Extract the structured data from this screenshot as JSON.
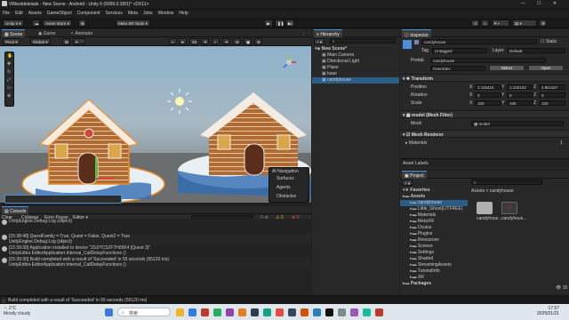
{
  "window": {
    "title": "VRtestdeletask - New Scene - Android - Unity 6 (6000.0.35f1)* <DX11>"
  },
  "menu": [
    "File",
    "Edit",
    "Assets",
    "GameObject",
    "Component",
    "Services",
    "Meta",
    "Jobs",
    "Window",
    "Help"
  ],
  "toolbar": {
    "account": "Unity 6",
    "asset_store": "Asset Store",
    "meta_tools": "Meta XR Tools"
  },
  "scene": {
    "tabs": [
      "Scene",
      "Game",
      "Animator"
    ],
    "pivot": "Pivot",
    "global": "Global",
    "view_2d": "2D",
    "overlay_items": [
      "AI Navigation",
      "Surfaces",
      "Agents",
      "Obstacles"
    ]
  },
  "hierarchy": {
    "tab": "Hierarchy",
    "items": [
      {
        "label": "New Scene*",
        "indent": 0,
        "selected": false,
        "bold": true
      },
      {
        "label": "Main Camera",
        "indent": 1,
        "selected": false,
        "bold": false
      },
      {
        "label": "Directional Light",
        "indent": 1,
        "selected": false,
        "bold": false
      },
      {
        "label": "Plane",
        "indent": 1,
        "selected": false,
        "bold": false
      },
      {
        "label": "base",
        "indent": 1,
        "selected": false,
        "bold": false
      },
      {
        "label": "candyhouse",
        "indent": 1,
        "selected": true,
        "bold": false
      }
    ]
  },
  "inspector": {
    "tab": "Inspector",
    "object_name": "candyhouse",
    "static_label": "Static",
    "tag_label": "Tag",
    "tag_value": "Untagged",
    "layer_label": "Layer",
    "layer_value": "Default",
    "prefab_label": "Prefab",
    "prefab_value": "candyhouse",
    "overrides": "Overrides",
    "select": "Select",
    "open": "Open",
    "transform": {
      "title": "Transform",
      "rows": [
        {
          "label": "Position",
          "x": "2.116315",
          "y": "1.102102",
          "z": "4.851167"
        },
        {
          "label": "Rotation",
          "x": "0",
          "y": "0",
          "z": "0"
        },
        {
          "label": "Scale",
          "x": "100",
          "y": "100",
          "z": "100"
        }
      ]
    },
    "mesh_filter": {
      "title": "model (Mesh Filter)",
      "mesh_label": "Mesh",
      "mesh_value": "model"
    },
    "mesh_renderer": {
      "title": "Mesh Renderer"
    },
    "materials_label": "Materials",
    "materials_count": "1",
    "asset_labels": "Asset Labels"
  },
  "project": {
    "tab": "Project",
    "tree": [
      {
        "label": "Favorites",
        "indent": 0,
        "bold": true
      },
      {
        "label": "Assets",
        "indent": 0,
        "bold": true
      },
      {
        "label": "candyhouse",
        "indent": 1,
        "bold": false,
        "selected": true
      },
      {
        "label": "Little_Ghost(LITFREE)",
        "indent": 1,
        "bold": false
      },
      {
        "label": "Materials",
        "indent": 1,
        "bold": false
      },
      {
        "label": "MetaXR",
        "indent": 1,
        "bold": false
      },
      {
        "label": "Oculus",
        "indent": 1,
        "bold": false
      },
      {
        "label": "Plugins",
        "indent": 1,
        "bold": false
      },
      {
        "label": "Resources",
        "indent": 1,
        "bold": false
      },
      {
        "label": "Scenes",
        "indent": 1,
        "bold": false
      },
      {
        "label": "Settings",
        "indent": 1,
        "bold": false
      },
      {
        "label": "Shaded",
        "indent": 1,
        "bold": false
      },
      {
        "label": "StreamingAssets",
        "indent": 1,
        "bold": false
      },
      {
        "label": "TutorialInfo",
        "indent": 1,
        "bold": false
      },
      {
        "label": "XR",
        "indent": 1,
        "bold": false
      },
      {
        "label": "Packages",
        "indent": 0,
        "bold": true
      }
    ],
    "breadcrumb_root": "Assets",
    "breadcrumb_sep": ">",
    "breadcrumb_current": "candyhouse",
    "assets": [
      {
        "label": "candyhous..."
      },
      {
        "label": "candyhous..."
      }
    ],
    "count": "15"
  },
  "console": {
    "tab": "Console",
    "clear": "Clear",
    "collapse": "Collapse",
    "error_pause": "Error Pause",
    "editor": "Editor",
    "counts": [
      "0",
      "0",
      "0"
    ],
    "rows": [
      {
        "line1": "UnityEngine.Debug:Log (object)",
        "line2": ""
      },
      {
        "line1": "[15:38:48] QuestFamily = True, Quest = False, Quest2 = True",
        "line2": "UnityEngine.Debug:Log (object)"
      },
      {
        "line1": "[15:39:30] Application installed to device \"2G0YC5ZF7H05K4 [Quest 3]\".",
        "line2": "UnityEditor.EditorApplication:Internal_CallDelayFunctions ()"
      },
      {
        "line1": "[15:39:30] Build completed with a result of 'Succeeded' in 55 seconds (55120 ms)",
        "line2": "UnityEditor.EditorApplication:Internal_CallDelayFunctions ()"
      }
    ]
  },
  "statusbar": {
    "text": "Build completed with a result of 'Succeeded' in 55 seconds (55120 ms)"
  },
  "taskbar": {
    "weather_temp": "2°C",
    "weather_desc": "Mostly cloudy",
    "search": "検索",
    "time": "17:57",
    "date": "2025/01/21"
  },
  "colors": {
    "selection": "#2c5d87",
    "accent": "#4a90d9",
    "sky": "#7aa6c2",
    "ground": "#7b5f3f"
  }
}
